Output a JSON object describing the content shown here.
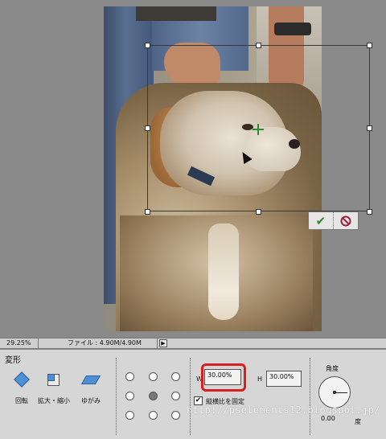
{
  "status": {
    "zoom": "29.25%",
    "file_info": "ファイル : 4.90M/4.90M",
    "menu_arrow": "▶"
  },
  "commit": {
    "accept_glyph": "✔",
    "cancel_glyph": "⃠"
  },
  "options": {
    "title": "変形",
    "tools": [
      {
        "label": "回転",
        "icon": "rotate-icon"
      },
      {
        "label": "拡大・縮小",
        "icon": "scale-icon"
      },
      {
        "label": "ゆがみ",
        "icon": "skew-icon"
      }
    ],
    "w_label": "W",
    "w_value": "30.00%",
    "h_label": "H",
    "h_value": "30.00%",
    "aspect_label": "縦横比を固定",
    "aspect_checked_glyph": "✔",
    "angle_label": "角度",
    "angle_value": "0.00",
    "angle_unit": "度"
  },
  "watermark": "http://pselements12.blogspot.jp/",
  "colors": {
    "highlight": "#d81e1e",
    "accent_blue": "#4f8fd6",
    "commit_green": "#2f8a2a",
    "cancel_red": "#a0203a"
  }
}
